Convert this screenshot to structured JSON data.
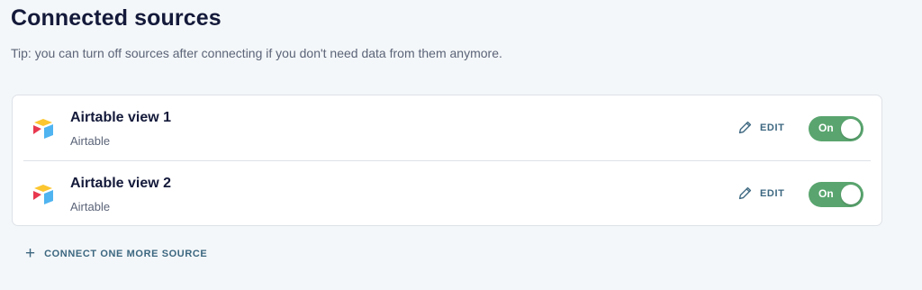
{
  "header": {
    "title": "Connected sources",
    "tip": "Tip: you can turn off sources after connecting if you don't need data from them anymore."
  },
  "sources": [
    {
      "name": "Airtable view 1",
      "type": "Airtable",
      "edit_label": "EDIT",
      "toggle_label": "On",
      "icon": "airtable-logo-icon"
    },
    {
      "name": "Airtable view 2",
      "type": "Airtable",
      "edit_label": "EDIT",
      "toggle_label": "On",
      "icon": "airtable-logo-icon"
    }
  ],
  "connect": {
    "label": "CONNECT ONE MORE SOURCE",
    "icon": "plus-icon"
  },
  "colors": {
    "accent": "#3c6780",
    "toggle_on": "#5aa56f",
    "airtable_yellow": "#fcc630",
    "airtable_red": "#e8384f",
    "airtable_blue": "#4fb4f0"
  }
}
